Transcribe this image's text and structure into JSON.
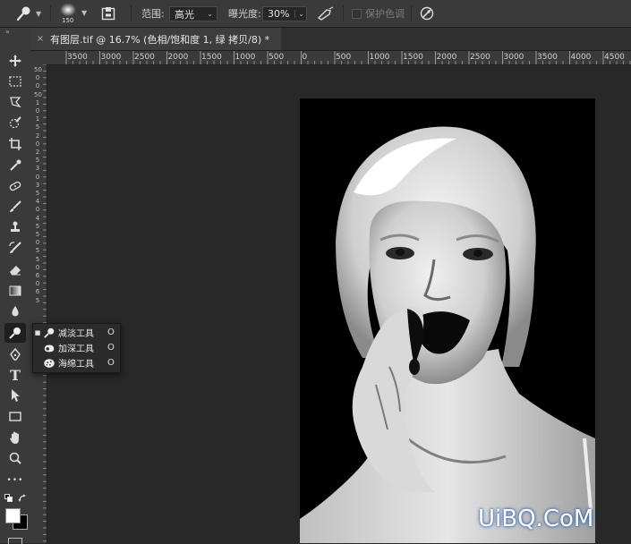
{
  "options_bar": {
    "brush_size": "150",
    "range_label": "范围:",
    "range_value": "高光",
    "exposure_label": "曝光度:",
    "exposure_value": "30%",
    "protect_tones_label": "保护色调"
  },
  "document_tab": {
    "close": "×",
    "title": "有图层.tif @ 16.7% (色相/饱和度 1, 绿 拷贝/8) *"
  },
  "ruler_top": {
    "labels": [
      "3500",
      "3000",
      "2500",
      "2000",
      "1500",
      "1000",
      "500",
      "0",
      "500",
      "1000",
      "1500",
      "2000",
      "2500",
      "3000",
      "3500",
      "4000",
      "4500"
    ]
  },
  "ruler_left": {
    "labels": [
      "50",
      "0",
      "0",
      "50",
      "1",
      "0",
      "1",
      "5",
      "2",
      "0",
      "2",
      "5",
      "3",
      "0",
      "3",
      "5",
      "4",
      "0",
      "4",
      "5",
      "5",
      "0",
      "5",
      "5",
      "0",
      "6",
      "0",
      "6",
      "5"
    ]
  },
  "toolbar": {
    "collapse": "»",
    "tools": [
      "move-icon",
      "marquee-icon",
      "lasso-icon",
      "quick-select-icon",
      "crop-icon",
      "eyedropper-icon",
      "healing-icon",
      "brush-icon",
      "stamp-icon",
      "history-brush-icon",
      "eraser-icon",
      "gradient-icon",
      "blur-icon",
      "dodge-icon",
      "pen-icon",
      "type-icon",
      "path-select-icon",
      "rectangle-icon",
      "hand-icon",
      "zoom-icon",
      "more-icon"
    ],
    "type_glyph": "T",
    "more_glyph": "•••"
  },
  "flyout": {
    "items": [
      {
        "label": "减淡工具",
        "key": "O",
        "icon": "dodge-icon",
        "active": true
      },
      {
        "label": "加深工具",
        "key": "O",
        "icon": "burn-icon",
        "active": false
      },
      {
        "label": "海绵工具",
        "key": "O",
        "icon": "sponge-icon",
        "active": false
      }
    ],
    "bullet": "■"
  },
  "watermark": "UiBQ.CoM",
  "colors": {
    "ui_bg": "#3a3a3a",
    "canvas_bg": "#282828",
    "watermark_glow": "#2b5fb0"
  }
}
